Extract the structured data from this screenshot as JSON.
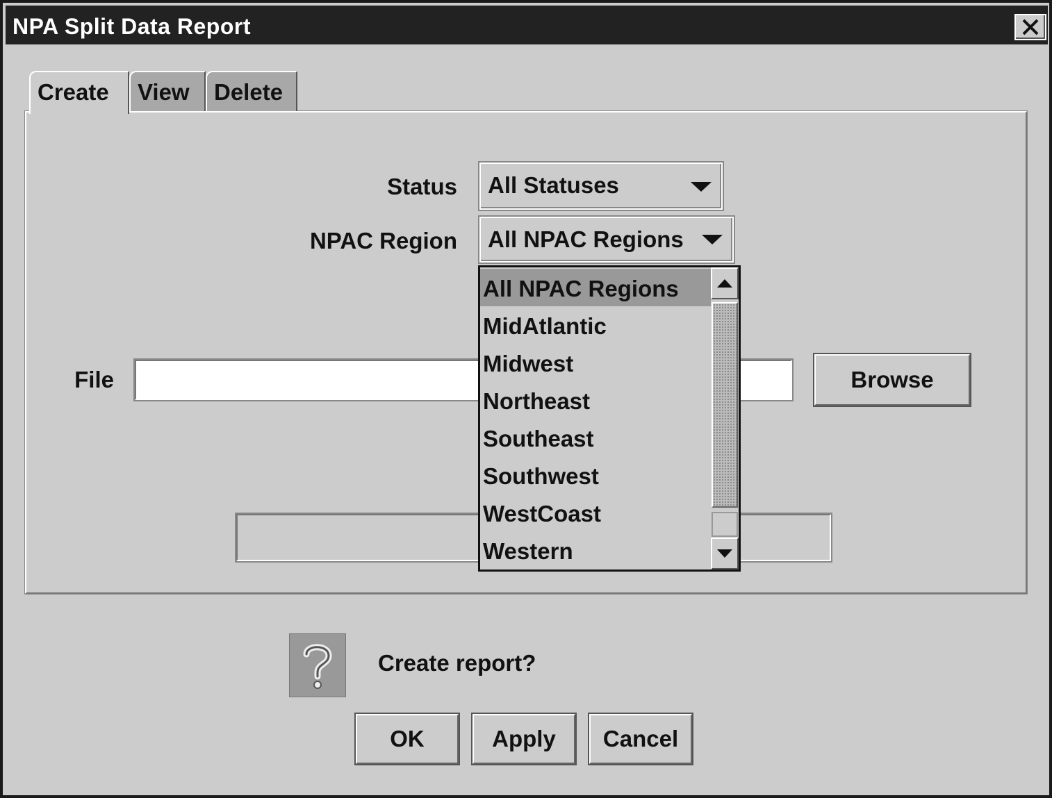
{
  "window": {
    "title": "NPA Split Data Report",
    "close_icon": "close-icon"
  },
  "tabs": [
    {
      "label": "Create",
      "active": true
    },
    {
      "label": "View",
      "active": false
    },
    {
      "label": "Delete",
      "active": false
    }
  ],
  "form": {
    "status": {
      "label": "Status",
      "value": "All Statuses"
    },
    "npac_region": {
      "label": "NPAC Region",
      "value": "All NPAC Regions"
    },
    "file": {
      "label": "File",
      "value": "",
      "placeholder": ""
    },
    "browse_label": "Browse"
  },
  "npac_dropdown": {
    "options": [
      "All NPAC Regions",
      "MidAtlantic",
      "Midwest",
      "Northeast",
      "Southeast",
      "Southwest",
      "WestCoast",
      "Western"
    ],
    "selected": "All NPAC Regions"
  },
  "dialog": {
    "icon": "question-icon",
    "message": "Create report?",
    "ok_label": "OK",
    "apply_label": "Apply",
    "cancel_label": "Cancel"
  }
}
